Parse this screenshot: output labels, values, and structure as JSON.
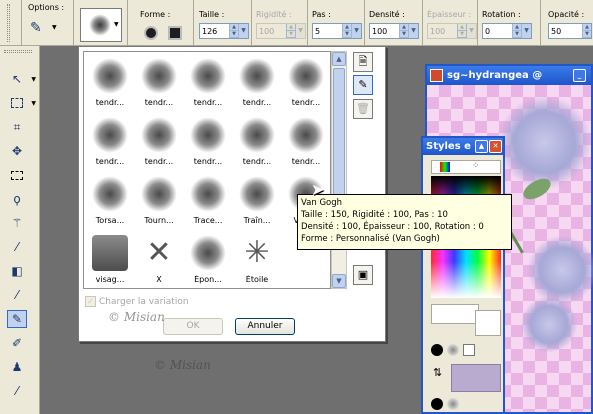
{
  "options_bar": {
    "options_label": "Options :",
    "forme_label": "Forme :",
    "taille_label": "Taille :",
    "taille_value": "126",
    "rigidite_label": "Rigidité :",
    "rigidite_value": "100",
    "pas_label": "Pas :",
    "pas_value": "5",
    "densite_label": "Densité :",
    "densite_value": "100",
    "epaisseur_label": "Épaisseur :",
    "epaisseur_value": "100",
    "rotation_label": "Rotation :",
    "rotation_value": "0",
    "opacite_label": "Opacité :",
    "opacite_value": "50"
  },
  "brush_popup": {
    "brushes": [
      {
        "label": "tendr..."
      },
      {
        "label": "tendr..."
      },
      {
        "label": "tendr..."
      },
      {
        "label": "tendr..."
      },
      {
        "label": "tendr..."
      },
      {
        "label": "tendr..."
      },
      {
        "label": "tendr..."
      },
      {
        "label": "tendr..."
      },
      {
        "label": "tendr..."
      },
      {
        "label": "tendr..."
      },
      {
        "label": "Torsa..."
      },
      {
        "label": "Tourn..."
      },
      {
        "label": "Trace..."
      },
      {
        "label": "Traîn..."
      },
      {
        "label": "Van ..."
      },
      {
        "label": "visag..."
      },
      {
        "label": "X"
      },
      {
        "label": "Épon..."
      },
      {
        "label": "Étoile"
      },
      {
        "label": ""
      }
    ],
    "checkbox_label": "Charger la variation",
    "ok_label": "OK",
    "cancel_label": "Annuler"
  },
  "tooltip": {
    "line1": "Van Gogh",
    "line2": "Taille : 150, Rigidité : 100, Pas : 10",
    "line3": "Densité : 100, Épaisseur : 100, Rotation : 0",
    "line4": "Forme : Personnalisé (Van Gogh)"
  },
  "image_window": {
    "title": "sg~hydrangea @"
  },
  "styles_palette": {
    "title": "Styles e"
  },
  "watermark": "© Misian",
  "icons": [
    "arrow-icon",
    "select-icon",
    "crop-icon",
    "move-icon",
    "lasso-icon",
    "wand-icon",
    "dropper-icon",
    "paint-brush-icon",
    "clone-icon",
    "eraser-icon"
  ]
}
